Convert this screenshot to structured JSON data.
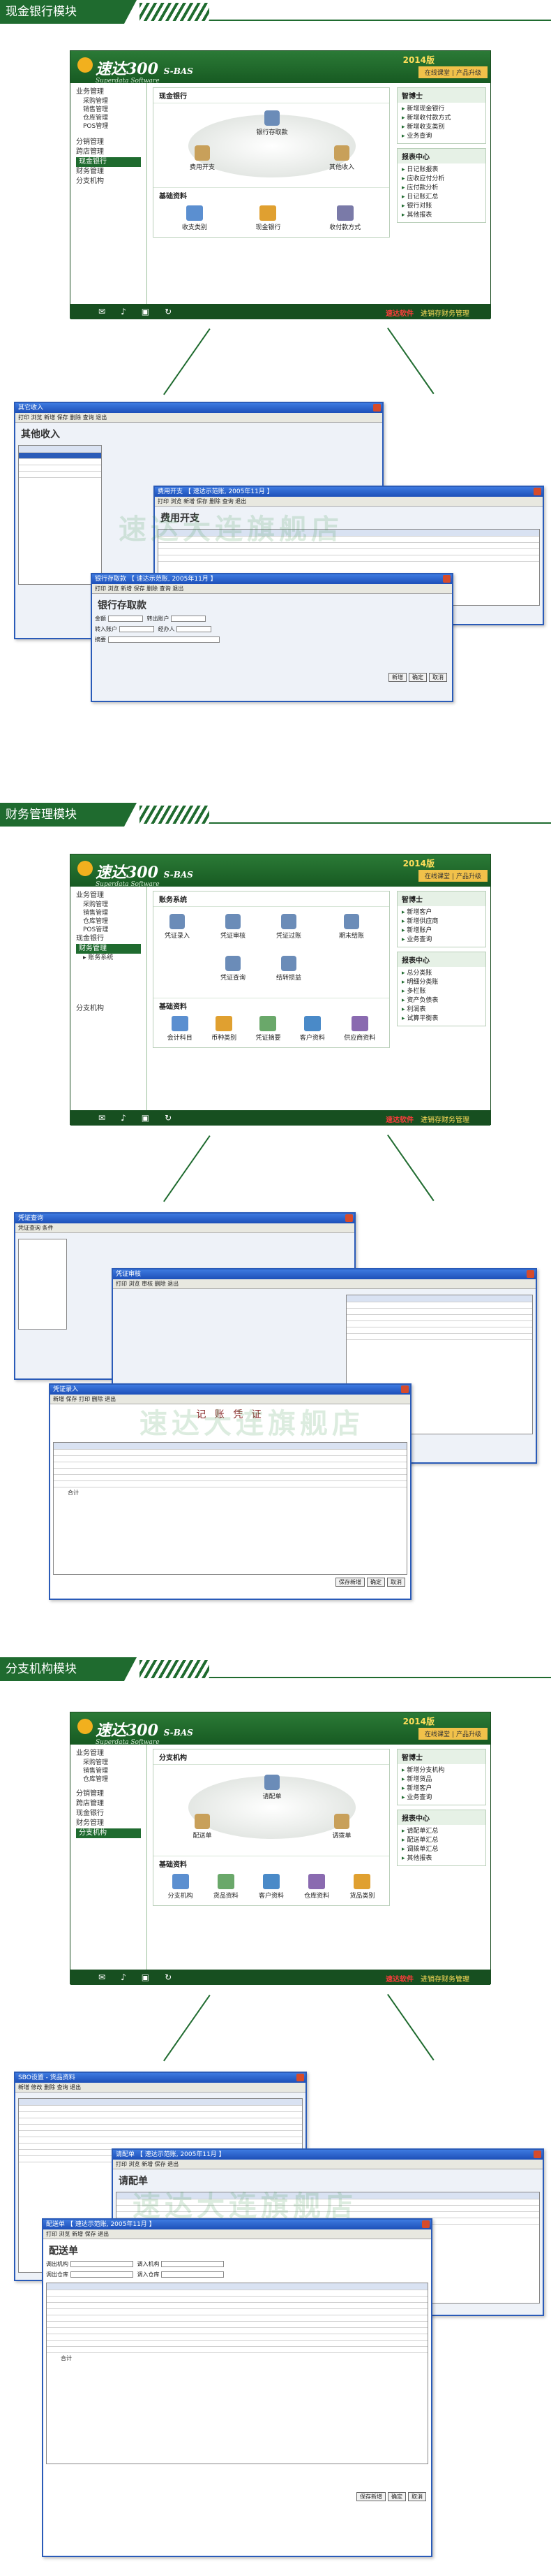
{
  "app": {
    "logo": "速达300",
    "logo_suffix": "S-BAS",
    "logo_sub": "Superdata Software",
    "year": "2014版",
    "toplinks": [
      "在线课堂",
      "产品升级"
    ],
    "slogan_red": "速达软件",
    "slogan": "进销存财务管理"
  },
  "sections": [
    {
      "title": "现金银行模块",
      "sidebar": [
        "业务管理",
        "采购管理",
        "销售管理",
        "仓库管理",
        "POS管理",
        "分销管理",
        "跨店管理",
        "现金银行",
        "财务管理",
        "分支机构"
      ],
      "sidebar_active": "现金银行",
      "panel_title": "现金银行",
      "nodes": [
        "银行存取款",
        "费用开支",
        "其他收入"
      ],
      "base_title": "基础资料",
      "base": [
        "收支类别",
        "现金银行",
        "收付款方式"
      ],
      "tips_title": "智博士",
      "tips": [
        "新增现金银行",
        "新增收付款方式",
        "新增收支类别",
        "业务查询"
      ],
      "report_title": "报表中心",
      "reports": [
        "日记账报表",
        "应收应付分析",
        "应付款分析",
        "日记账汇总",
        "银行对账",
        "其他报表"
      ]
    },
    {
      "title": "财务管理模块",
      "sidebar": [
        "业务管理",
        "采购管理",
        "销售管理",
        "仓库管理",
        "POS管理",
        "现金银行",
        "财务管理",
        "分支机构"
      ],
      "sidebar_active": "财务管理",
      "sidebar_sub": "▸ 账务系统",
      "panel_title": "账务系统",
      "nodes": [
        "凭证录入",
        "凭证审核",
        "凭证过账",
        "期末结账",
        "凭证查询",
        "结转损益"
      ],
      "base_title": "基础资料",
      "base": [
        "会计科目",
        "币种类别",
        "凭证摘要",
        "客户资料",
        "供应商资料"
      ],
      "tips_title": "智博士",
      "tips": [
        "新增客户",
        "新增供应商",
        "新增账户",
        "业务查询"
      ],
      "report_title": "报表中心",
      "reports": [
        "总分类账",
        "明细分类账",
        "多栏账",
        "资产负债表",
        "利润表",
        "试算平衡表"
      ]
    },
    {
      "title": "分支机构模块",
      "sidebar": [
        "业务管理",
        "采购管理",
        "销售管理",
        "仓库管理",
        "分销管理",
        "跨店管理",
        "现金银行",
        "财务管理",
        "分支机构"
      ],
      "sidebar_active": "分支机构",
      "panel_title": "分支机构",
      "nodes": [
        "请配单",
        "配送单",
        "调拨单"
      ],
      "base_title": "基础资料",
      "base": [
        "分支机构",
        "货品资料",
        "客户资料",
        "仓库资料",
        "货品类别"
      ],
      "tips_title": "智博士",
      "tips": [
        "新增分支机构",
        "新增货品",
        "新增客户",
        "业务查询"
      ],
      "report_title": "报表中心",
      "reports": [
        "请配单汇总",
        "配送单汇总",
        "调拨单汇总",
        "其他报表"
      ]
    }
  ],
  "collages": [
    {
      "watermark": "速达大连旗舰店",
      "windows": [
        {
          "title": "其它收入",
          "heading": "其他收入",
          "tools": "打印 浏览 新增 保存 删除 查询 退出"
        },
        {
          "title": "费用开支 【 速达示范账, 2005年11月 】",
          "heading": "费用开支",
          "tools": "打印 浏览 新增 保存 删除 查询 退出"
        },
        {
          "title": "银行存取款 【 速达示范账, 2005年11月 】",
          "heading": "银行存取款",
          "tools": "打印 浏览 新增 保存 删除 查询 退出",
          "fields": [
            "金额",
            "转出账户",
            "转入账户",
            "经办人",
            "摘要"
          ],
          "buttons": [
            "新增",
            "确定",
            "取消"
          ]
        }
      ]
    },
    {
      "watermark": "速达大连旗舰店",
      "windows": [
        {
          "title": "凭证查询",
          "heading": "",
          "tools": "凭证查询 条件"
        },
        {
          "title": "凭证审核",
          "heading": "",
          "tools": "打印 浏览 审核 删除 退出"
        },
        {
          "title": "凭证录入",
          "heading": "记 账 凭 证",
          "tools": "新增 保存 打印 删除 退出",
          "footer": "合计",
          "buttons": [
            "保存新增",
            "确定",
            "取消"
          ]
        }
      ]
    },
    {
      "watermark": "速达大连旗舰店",
      "windows": [
        {
          "title": "SBO设置 - 货品资料",
          "heading": "",
          "tools": "新增 修改 删除 查询 退出"
        },
        {
          "title": "请配单 【 速达示范账, 2005年11月 】",
          "heading": "请配单",
          "tools": "打印 浏览 新增 保存 退出"
        },
        {
          "title": "配送单 【 速达示范账, 2005年11月 】",
          "heading": "配送单",
          "tools": "打印 浏览 新增 保存 退出",
          "fields": [
            "调出机构",
            "调出仓库",
            "调入机构",
            "调入仓库"
          ],
          "footer": "合计",
          "buttons": [
            "保存新增",
            "确定",
            "取消"
          ]
        }
      ]
    }
  ]
}
